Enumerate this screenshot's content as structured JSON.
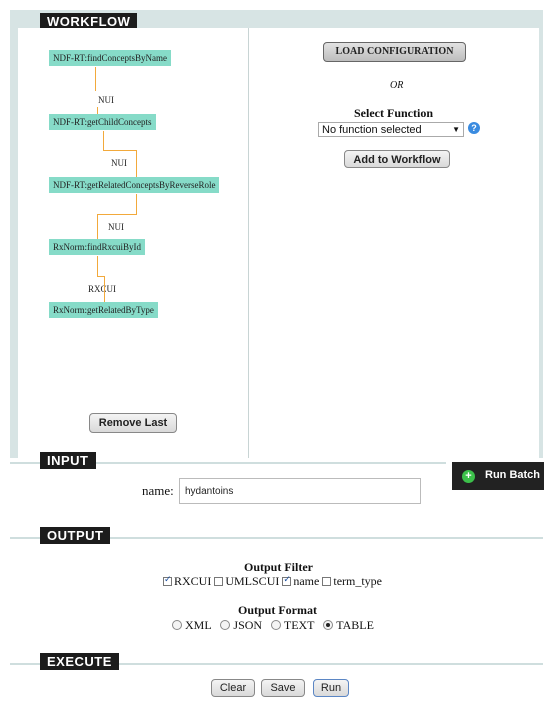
{
  "workflow": {
    "title": "WORKFLOW",
    "nodes": [
      "NDF-RT:findConceptsByName",
      "NDF-RT:getChildConcepts",
      "NDF-RT:getRelatedConceptsByReverseRole",
      "RxNorm:findRxcuiById",
      "RxNorm:getRelatedByType"
    ],
    "connectors": [
      "NUI",
      "NUI",
      "NUI",
      "RXCUI"
    ],
    "remove_last_label": "Remove Last",
    "load_config_label": "LOAD CONFIGURATION",
    "or_text": "OR",
    "select_function_label": "Select Function",
    "select_value": "No function selected",
    "help_glyph": "?",
    "add_label": "Add to Workflow"
  },
  "input": {
    "title": "INPUT",
    "name_label": "name:",
    "name_value": "hydantoins",
    "run_batch_label": "Run Batch"
  },
  "output": {
    "title": "OUTPUT",
    "filter_title": "Output Filter",
    "filters": [
      {
        "label": "RXCUI",
        "checked": true
      },
      {
        "label": "UMLSCUI",
        "checked": false
      },
      {
        "label": "name",
        "checked": true
      },
      {
        "label": "term_type",
        "checked": false
      }
    ],
    "format_title": "Output Format",
    "formats": [
      {
        "label": "XML",
        "selected": false
      },
      {
        "label": "JSON",
        "selected": false
      },
      {
        "label": "TEXT",
        "selected": false
      },
      {
        "label": "TABLE",
        "selected": true
      }
    ]
  },
  "execute": {
    "title": "EXECUTE",
    "clear_label": "Clear",
    "save_label": "Save",
    "run_label": "Run"
  },
  "colors": {
    "node_fill": "#86dbc8",
    "connector": "#f2a93b",
    "header_bg": "#1c1c1c",
    "panel_bg": "#d7e4e4",
    "run_batch_icon": "#3cc04a"
  }
}
